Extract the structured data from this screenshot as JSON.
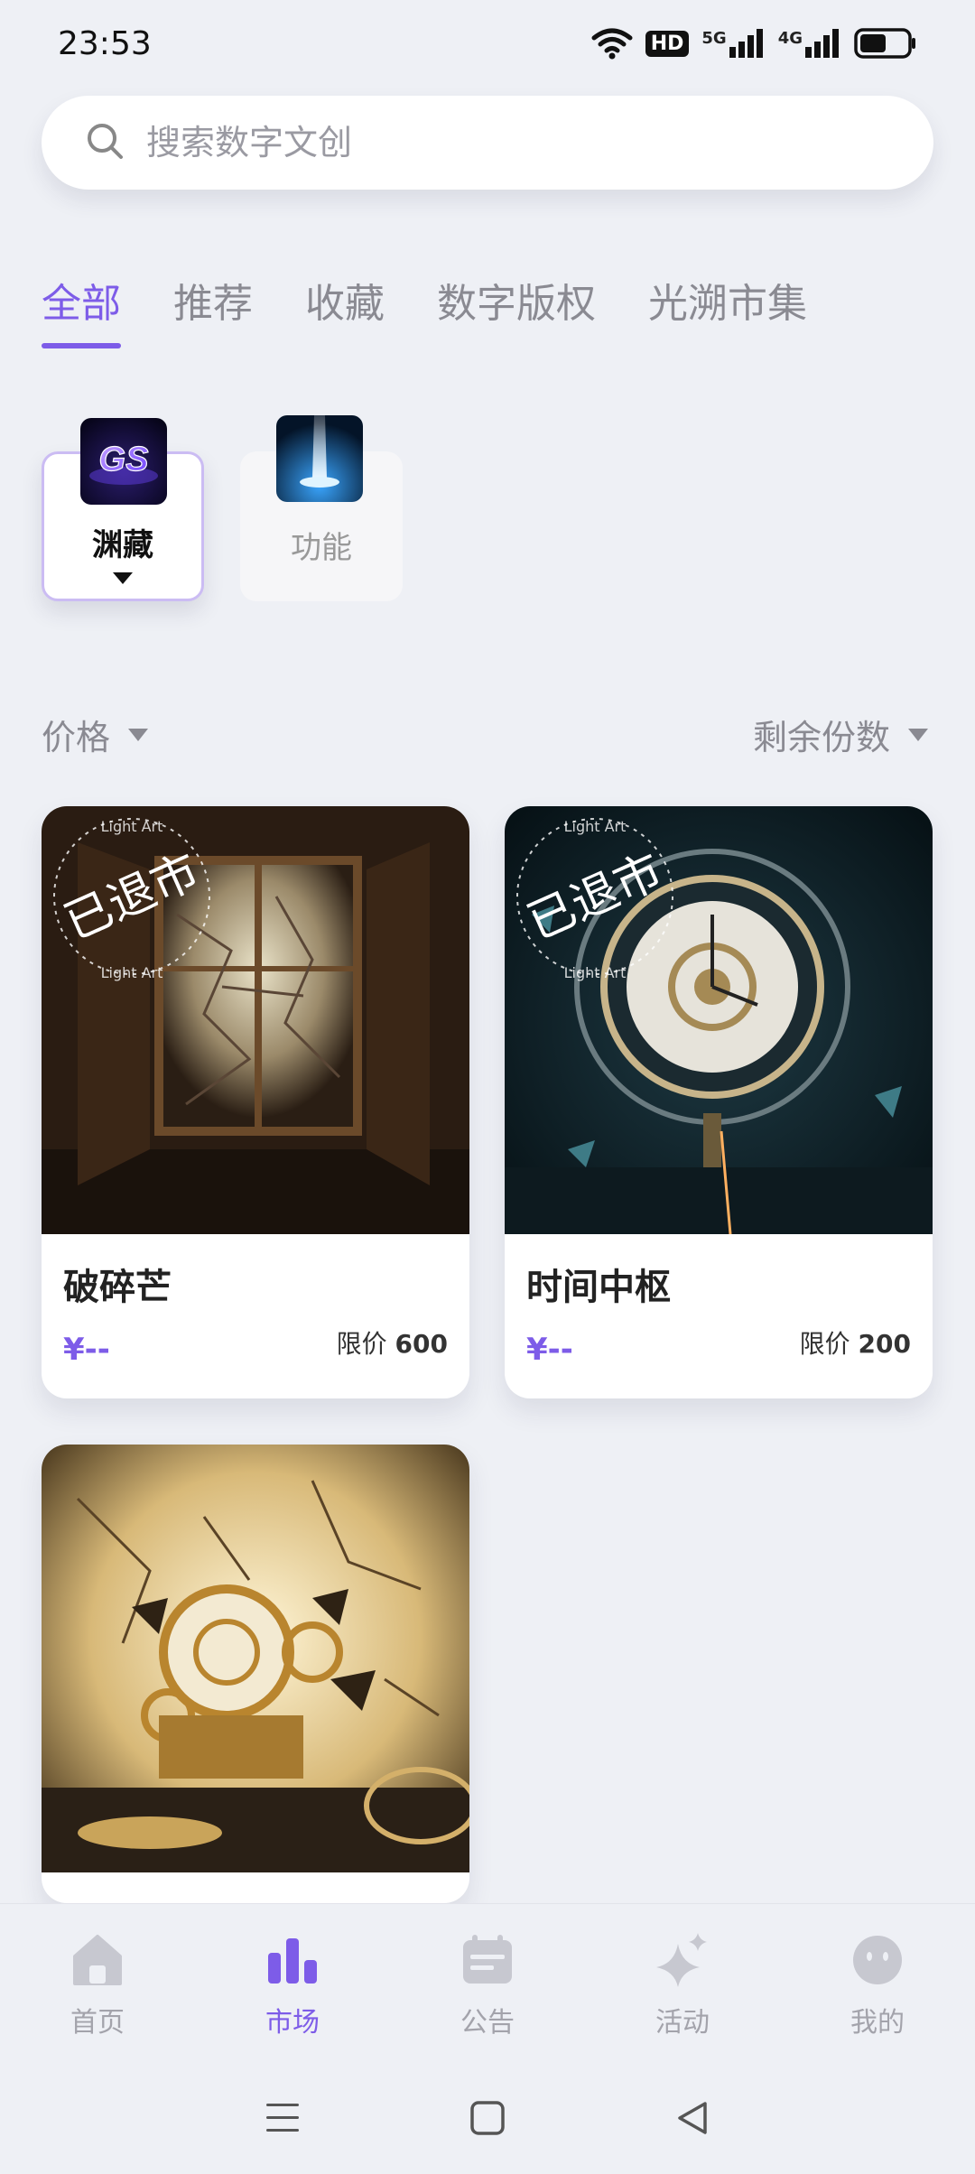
{
  "status_bar": {
    "time": "23:53",
    "hd_label": "HD",
    "net_5g": "5G",
    "net_4g": "4G"
  },
  "search": {
    "placeholder": "搜索数字文创"
  },
  "tabs": [
    {
      "label": "全部",
      "active": true
    },
    {
      "label": "推荐"
    },
    {
      "label": "收藏"
    },
    {
      "label": "数字版权"
    },
    {
      "label": "光溯市集"
    }
  ],
  "categories": [
    {
      "label": "渊藏",
      "thumb_text": "GS",
      "selected": true
    },
    {
      "label": "功能"
    }
  ],
  "sort": {
    "price_label": "价格",
    "remaining_label": "剩余份数"
  },
  "cards": [
    {
      "title": "破碎芒",
      "price": "¥--",
      "limit_label": "限价",
      "limit_value": "600",
      "stamp": "已退市",
      "watermark": "Light Art"
    },
    {
      "title": "时间中枢",
      "price": "¥--",
      "limit_label": "限价",
      "limit_value": "200",
      "stamp": "已退市",
      "watermark": "Light Art"
    },
    {
      "title": "",
      "price": "",
      "limit_label": "",
      "limit_value": ""
    }
  ],
  "bottom_nav": [
    {
      "label": "首页",
      "icon": "home-icon"
    },
    {
      "label": "市场",
      "icon": "market-icon",
      "active": true
    },
    {
      "label": "公告",
      "icon": "notice-icon"
    },
    {
      "label": "活动",
      "icon": "sparkle-icon"
    },
    {
      "label": "我的",
      "icon": "profile-icon"
    }
  ],
  "colors": {
    "accent": "#7d5ce8",
    "background": "#eef0f5"
  }
}
